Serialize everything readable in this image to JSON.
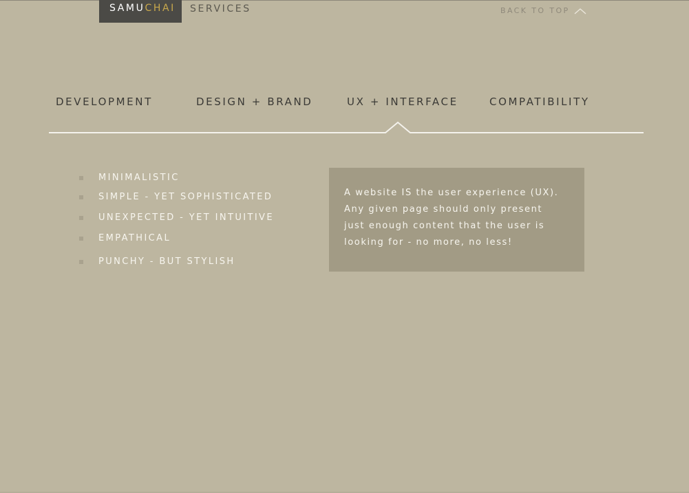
{
  "header": {
    "logo_primary": "SAMU",
    "logo_accent": "CHAI",
    "section_label": "SERVICES",
    "back_to_top": "BACK TO TOP"
  },
  "tabs": [
    {
      "label": "DEVELOPMENT",
      "active": false
    },
    {
      "label": "DESIGN + BRAND",
      "active": false
    },
    {
      "label": "UX + INTERFACE",
      "active": true
    },
    {
      "label": "COMPATIBILITY",
      "active": false
    }
  ],
  "features": [
    "MINIMALISTIC",
    "SIMPLE - YET SOPHISTICATED",
    "UNEXPECTED - YET INTUITIVE",
    "EMPATHICAL",
    "PUNCHY - BUT STYLISH"
  ],
  "info_box": {
    "lines": [
      "A website IS the user experience (UX).",
      "Any given page should only present",
      "just enough content that the user is",
      "looking for - no more, no less!"
    ]
  },
  "colors": {
    "background": "#bdb6a0",
    "logo_background": "#4b4a46",
    "logo_accent": "#c9a94c",
    "info_box_background": "#a29b85"
  },
  "icons": {
    "back_to_top": "chevron-up-icon",
    "feature_bullet": "square-bullet"
  }
}
